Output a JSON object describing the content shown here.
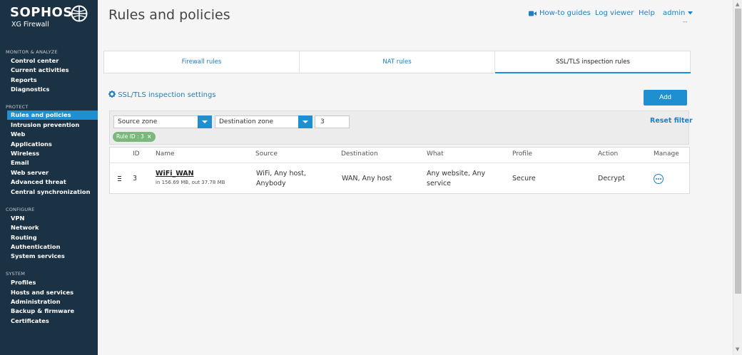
{
  "brand": {
    "name": "SOPHOS",
    "product": "XG Firewall"
  },
  "sidebar": {
    "sections": [
      {
        "title": "MONITOR & ANALYZE",
        "items": [
          "Control center",
          "Current activities",
          "Reports",
          "Diagnostics"
        ]
      },
      {
        "title": "PROTECT",
        "items": [
          "Rules and policies",
          "Intrusion prevention",
          "Web",
          "Applications",
          "Wireless",
          "Email",
          "Web server",
          "Advanced threat",
          "Central synchronization"
        ]
      },
      {
        "title": "CONFIGURE",
        "items": [
          "VPN",
          "Network",
          "Routing",
          "Authentication",
          "System services"
        ]
      },
      {
        "title": "SYSTEM",
        "items": [
          "Profiles",
          "Hosts and services",
          "Administration",
          "Backup & firmware",
          "Certificates"
        ]
      }
    ],
    "active_item": "Rules and policies"
  },
  "header": {
    "title": "Rules and policies",
    "links": {
      "howto": "How-to guides",
      "logviewer": "Log viewer",
      "help": "Help",
      "admin": "admin"
    },
    "admin_sub": "--"
  },
  "tabs": [
    "Firewall rules",
    "NAT rules",
    "SSL/TLS inspection rules"
  ],
  "active_tab": "SSL/TLS inspection rules",
  "settings_link": "SSL/TLS inspection settings",
  "add_button": "Add",
  "filter": {
    "source_zone_placeholder": "Source zone",
    "destination_zone_placeholder": "Destination zone",
    "value": "3",
    "reset_label": "Reset filter",
    "chip": "Rule ID : 3"
  },
  "table": {
    "columns": [
      "ID",
      "Name",
      "Source",
      "Destination",
      "What",
      "Profile",
      "Action",
      "Manage"
    ],
    "rows": [
      {
        "id": "3",
        "name": "WiFi_WAN",
        "traffic": "in 156.69 MB, out 37.78 MB",
        "source_line1": "WiFi, Any host,",
        "source_line2": "Anybody",
        "destination": "WAN, Any host",
        "what_line1": "Any website, Any",
        "what_line2": "service",
        "profile": "Secure",
        "action": "Decrypt"
      }
    ]
  },
  "colors": {
    "sidebar_bg": "#1b3244",
    "accent": "#1e8fd1",
    "link": "#1e7fc4",
    "chip": "#7cb77b"
  }
}
